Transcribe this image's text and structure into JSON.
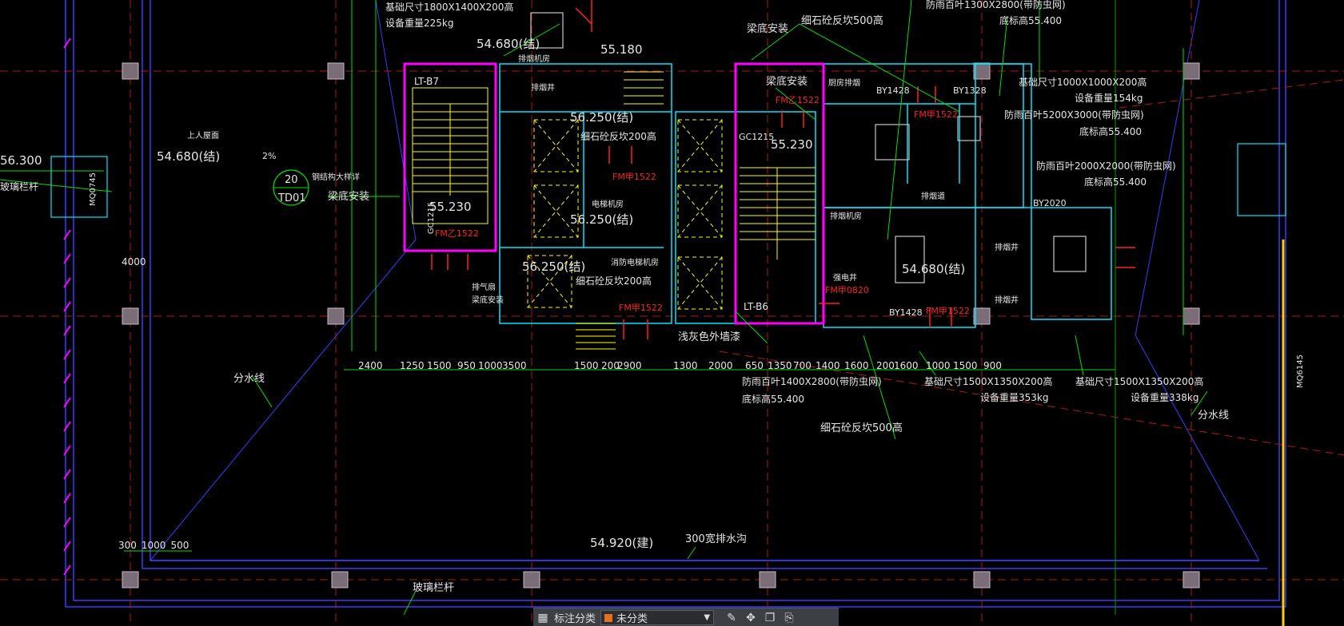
{
  "labels": {
    "roof_elev_left": "56.300",
    "glass_rail_left": "玻璃栏杆",
    "foundation_1": "基础尺寸1800X1400X200高",
    "weight_1": "设备重量225kg",
    "elev_54680_a": "54.680(结)",
    "fan_room_a": "排烟机房",
    "smoke_shaft_a": "排烟井",
    "roof_label": "上人屋面",
    "elev_54680_b": "54.680(结)",
    "elev_55180": "55.180",
    "slope_2pct": "2%",
    "callout_num": "20",
    "callout_code": "TD01",
    "glass_rail_install": "钢结构大样详",
    "beam_install_a": "梁底安装",
    "lt_b7": "LT-B7",
    "elev_55230_a": "55.230",
    "fm_a": "FM乙1522",
    "gc_a": "GC1215",
    "smoke_vent": "排气扇",
    "beam_install_b": "梁底安装",
    "elev_56250_a": "56.250(结)",
    "curb_a": "细石砼反坎200高",
    "fm_b": "FM甲1522",
    "elev_56250_b": "56.250(结)",
    "elev_room": "电梯机房",
    "elev_56250_c": "56.250(结)",
    "curb_b": "细石砼反坎200高",
    "fire_elev_room": "消防电梯机房",
    "fm_c": "FM甲1522",
    "c1215_a": "C1215",
    "wall_note": "浅灰色外墙漆",
    "curb_500_a": "细石砼反坎500高",
    "beam_install_c": "梁底安装",
    "beam_install_d": "梁底安装",
    "fm_d": "FM乙1522",
    "c1215_b": "C1215",
    "gc1215_b": "GC1215",
    "elev_55230_b": "55.230",
    "lt_b6": "LT-B6",
    "louver_a": "防雨百叶1300X2800(带防虫网)",
    "base_elev_a": "底标高55.400",
    "kitchen_smoke": "厨房排烟",
    "by1428_a": "BY1428",
    "by1328": "BY1328",
    "fm_e": "FM甲1522",
    "foundation_2": "基础尺寸1000X1000X200高",
    "weight_2": "设备重量154kg",
    "louver_b": "防雨百叶5200X3000(带防虫网)",
    "base_elev_b": "底标高55.400",
    "louver_c": "防雨百叶2000X2000(带防虫网)",
    "base_elev_c": "底标高55.400",
    "by2020": "BY2020",
    "smoke_exhaust": "排烟道",
    "smoke_room": "排烟机房",
    "elev_54680_c": "54.680(结)",
    "fm_f": "FM甲0820",
    "power_shaft": "强电井",
    "by1428_b": "BY1428",
    "fm_g": "FM甲1522",
    "fm_h": "FM甲1522",
    "smoke_shaft_b": "排烟井",
    "smoke_shaft_c": "排烟井",
    "louver_d": "防雨百叶1400X2800(带防虫网)",
    "base_elev_d": "底标高55.400",
    "curb_500_b": "细石砼反坎500高",
    "foundation_3": "基础尺寸1500X1350X200高",
    "weight_3": "设备重量353kg",
    "foundation_4": "基础尺寸1500X1350X200高",
    "weight_4": "设备重量338kg",
    "divide_left": "分水线",
    "divide_right": "分水线",
    "elev_54920": "54.920(建)",
    "drain_ditch": "300宽排水沟",
    "glass_rail_bottom": "玻璃栏杆",
    "mq_left": "MQ0745",
    "mq_right": "MQ6145",
    "dim_4000": "4000",
    "dim_row": [
      "2400",
      "1250",
      "1500",
      "950",
      "1000",
      "3500",
      "1500",
      "200",
      "2900",
      "1300",
      "2000",
      "650",
      "1350",
      "700",
      "1400",
      "1600",
      "200",
      "1600",
      "1000",
      "1500",
      "900"
    ],
    "dim_bottom_left": [
      "300",
      "1000",
      "500"
    ]
  },
  "toolbar": {
    "label": "标注分类",
    "selected": "未分类",
    "icons": [
      "grid-icon",
      "edit-icon",
      "move-icon",
      "copy-icon",
      "paste-icon"
    ]
  },
  "colors": {
    "background": "#000000",
    "cyan": "#00e5ff",
    "yellow": "#ffff00",
    "magenta": "#ff00ff",
    "red": "#ff2020",
    "green": "#00ff00",
    "blue": "#3a3aff",
    "white": "#e6e6e6"
  }
}
